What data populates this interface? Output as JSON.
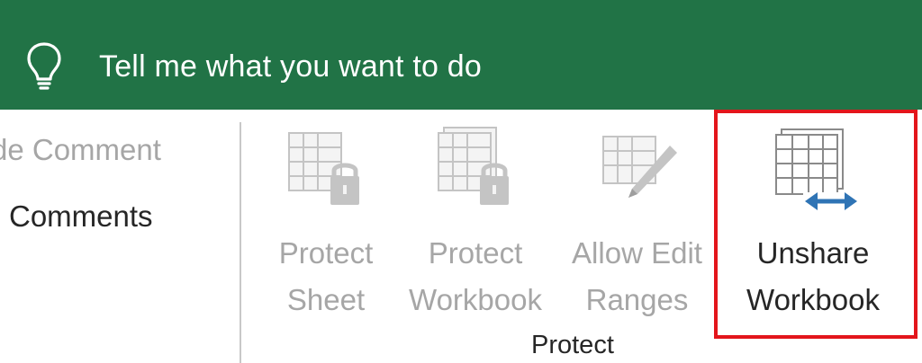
{
  "tell_me": {
    "text": "Tell me what you want to do",
    "icon": "lightbulb-icon"
  },
  "comments": {
    "hide_label": "de Comment",
    "show_label": "Comments"
  },
  "protect_group": {
    "label": "Protect",
    "buttons": [
      {
        "line1": "Protect",
        "line2": "Sheet",
        "enabled": false,
        "icon": "protect-sheet-icon"
      },
      {
        "line1": "Protect",
        "line2": "Workbook",
        "enabled": false,
        "icon": "protect-workbook-icon"
      },
      {
        "line1": "Allow Edit",
        "line2": "Ranges",
        "enabled": false,
        "icon": "allow-edit-ranges-icon"
      },
      {
        "line1": "Unshare",
        "line2": "Workbook",
        "enabled": true,
        "icon": "unshare-workbook-icon"
      }
    ]
  },
  "colors": {
    "title_bar": "#217346",
    "highlight_border": "#e3151b",
    "disabled_text": "#a6a6a6",
    "enabled_text": "#262626"
  }
}
